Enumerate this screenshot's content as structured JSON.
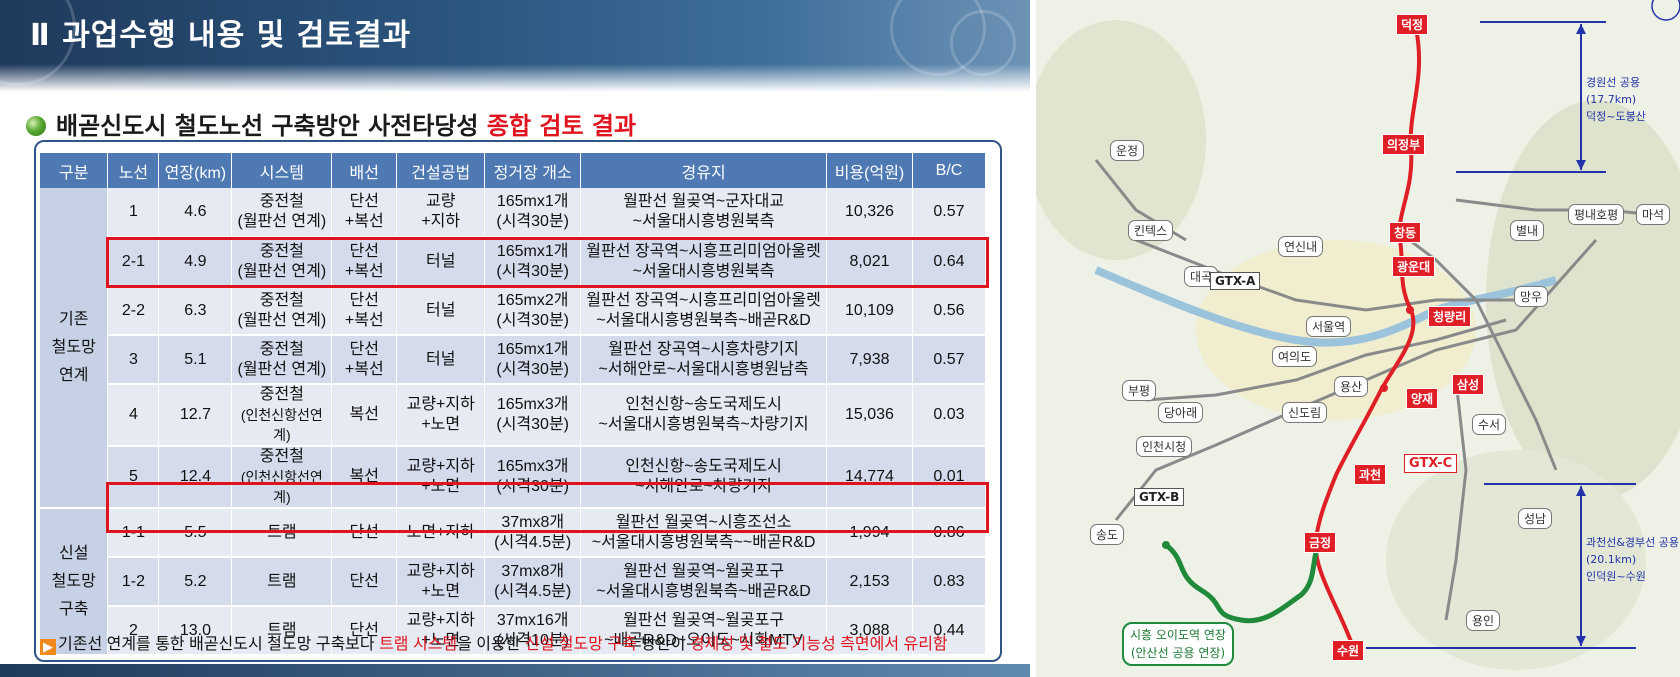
{
  "section_title": "Ⅱ 과업수행 내용 및 검토결과",
  "heading": {
    "main": "배곧신도시 철도노선 구축방안 사전타당성 ",
    "highlight": "종합 검토 결과"
  },
  "table": {
    "headers": [
      "구분",
      "노선",
      "연장(km)",
      "시스템",
      "배선",
      "건설공법",
      "정거장 개소",
      "경유지",
      "비용(억원)",
      "B/C"
    ],
    "groups": [
      {
        "label_lines": [
          "기존",
          "철도망",
          "연계"
        ]
      },
      {
        "label_lines": [
          "신설",
          "철도망",
          "구축"
        ]
      }
    ],
    "rows": [
      {
        "route": "1",
        "length": "4.6",
        "system": [
          "중전철",
          "(월판선 연계)"
        ],
        "track": [
          "단선",
          "+복선"
        ],
        "method": [
          "교량",
          "+지하"
        ],
        "stations": [
          "165mx1개",
          "(시격30분)"
        ],
        "via": [
          "월판선 월곶역~군자대교",
          "~서울대시흥병원북측"
        ],
        "cost": "10,326",
        "bc": "0.57"
      },
      {
        "route": "2-1",
        "length": "4.9",
        "system": [
          "중전철",
          "(월판선 연계)"
        ],
        "track": [
          "단선",
          "+복선"
        ],
        "method": [
          "터널"
        ],
        "stations": [
          "165mx1개",
          "(시격30분)"
        ],
        "via": [
          "월판선 장곡역~시흥프리미엄아울렛",
          "~서울대시흥병원북측"
        ],
        "cost": "8,021",
        "bc": "0.64"
      },
      {
        "route": "2-2",
        "length": "6.3",
        "system": [
          "중전철",
          "(월판선 연계)"
        ],
        "track": [
          "단선",
          "+복선"
        ],
        "method": [
          "터널"
        ],
        "stations": [
          "165mx2개",
          "(시격30분)"
        ],
        "via": [
          "월판선 장곡역~시흥프리미엄아울렛",
          "~서울대시흥병원북측~배곧R&D"
        ],
        "cost": "10,109",
        "bc": "0.56"
      },
      {
        "route": "3",
        "length": "5.1",
        "system": [
          "중전철",
          "(월판선 연계)"
        ],
        "track": [
          "단선",
          "+복선"
        ],
        "method": [
          "터널"
        ],
        "stations": [
          "165mx1개",
          "(시격30분)"
        ],
        "via": [
          "월판선 장곡역~시흥차량기지",
          "~서해안로~서울대시흥병원남측"
        ],
        "cost": "7,938",
        "bc": "0.57"
      },
      {
        "route": "4",
        "length": "12.7",
        "system": [
          "중전철",
          "(인천신항선연계)"
        ],
        "track": [
          "복선"
        ],
        "method": [
          "교량+지하",
          "+노면"
        ],
        "stations": [
          "165mx3개",
          "(시격30분)"
        ],
        "via": [
          "인천신항~송도국제도시",
          "~서울대시흥병원북측~차량기지"
        ],
        "cost": "15,036",
        "bc": "0.03"
      },
      {
        "route": "5",
        "length": "12.4",
        "system": [
          "중전철",
          "(인천신항선연계)"
        ],
        "track": [
          "복선"
        ],
        "method": [
          "교량+지하",
          "+노면"
        ],
        "stations": [
          "165mx3개",
          "(시격30분)"
        ],
        "via": [
          "인천신항~송도국제도시",
          "~서해안로~차량기지"
        ],
        "cost": "14,774",
        "bc": "0.01"
      },
      {
        "route": "1-1",
        "length": "5.5",
        "system": [
          "트램"
        ],
        "track": [
          "단선"
        ],
        "method": [
          "노면+지하"
        ],
        "stations": [
          "37mx8개",
          "(시격4.5분)"
        ],
        "via": [
          "월판선 월곶역~시흥조선소",
          "~서울대시흥병원북측~~배곧R&D"
        ],
        "cost": "1,994",
        "bc": "0.86"
      },
      {
        "route": "1-2",
        "length": "5.2",
        "system": [
          "트램"
        ],
        "track": [
          "단선"
        ],
        "method": [
          "교량+지하",
          "+노면"
        ],
        "stations": [
          "37mx8개",
          "(시격4.5분)"
        ],
        "via": [
          "월판선 월곶역~월곶포구",
          "~서울대시흥병원북측~배곧R&D"
        ],
        "cost": "2,153",
        "bc": "0.83"
      },
      {
        "route": "2",
        "length": "13.0",
        "system": [
          "트램"
        ],
        "track": [
          "단선"
        ],
        "method": [
          "교량+지하",
          "+노면"
        ],
        "stations": [
          "37mx16개",
          "(시격10분)"
        ],
        "via": [
          "월판선 월곶역~월곶포구",
          "~배곧R&D~오이도~시화MTV"
        ],
        "cost": "3,088",
        "bc": "0.44"
      }
    ]
  },
  "footnote": {
    "arrow": "▶",
    "p1": "기존선 연계를 통한 배곧신도시 철도망 구축보다 ",
    "r1": "트램 시스템",
    "p2": "을 이용한 ",
    "r2": "신설 철도망 구축",
    "p3": " 방안이 ",
    "r3": "경제성 및 철도 기능성 측면에서 유리함"
  },
  "map": {
    "stations": {
      "dukjeong": "덕정",
      "uijeongbu": "의정부",
      "changdong": "창동",
      "gwangundae": "광운대",
      "cheongnyangni": "청량리",
      "samseong": "삼성",
      "yangjae": "양재",
      "gwacheon": "과천",
      "geumjeong": "금정",
      "suwon": "수원"
    },
    "labels": {
      "unjeong": "운정",
      "kintex": "킨텍스",
      "daegok": "대곡",
      "yeonsinnae": "연신내",
      "seoul": "서울역",
      "yeouido": "여의도",
      "yongsan": "용산",
      "sindorim": "신도림",
      "bupyeong": "부평",
      "dangajeong": "당아래",
      "incheonsicheong": "인천시청",
      "songdo": "송도",
      "byeollae": "별내",
      "pyeongnae": "평내호평",
      "maseok": "마석",
      "mangu": "망우",
      "suseo": "수서",
      "seongnam": "성남",
      "yongin": "용인"
    },
    "gtx": {
      "a": "GTX-A",
      "b": "GTX-B",
      "c": "GTX-C"
    },
    "note_north": [
      "경원선 공용",
      "(17.7km)",
      "덕정~도봉산"
    ],
    "note_south": [
      "과천선&경부선 공용",
      "(20.1km)",
      "인덕원~수원"
    ],
    "green_note": [
      "시흥 오이도역 연장",
      "(안산선 공용 연장)"
    ]
  },
  "colors": {
    "header_blue": "#4e79b3",
    "highlight_red": "#e0141e",
    "gtx_red": "#e01e26",
    "note_blue": "#2233aa",
    "green_ext": "#1e8a3a"
  }
}
